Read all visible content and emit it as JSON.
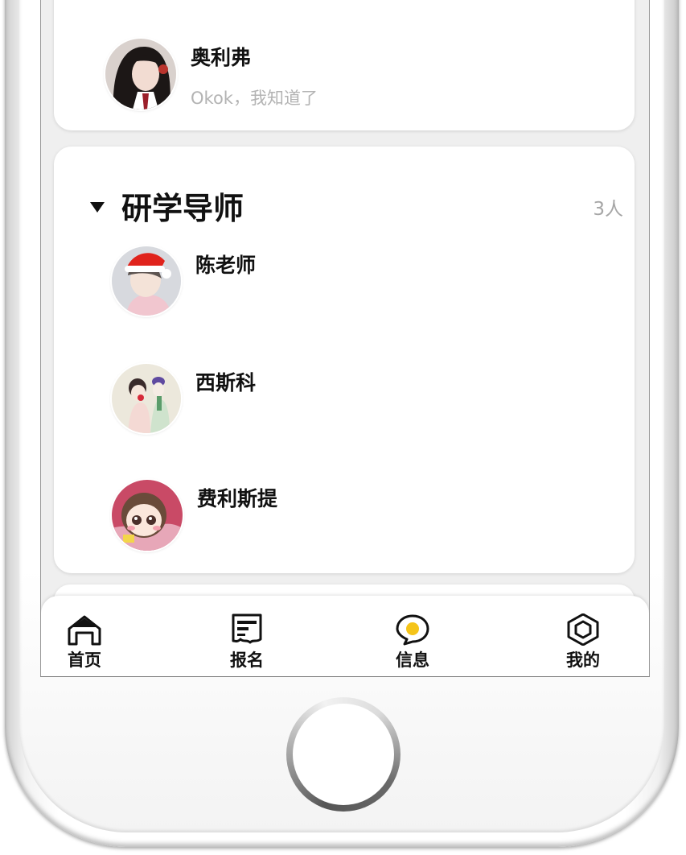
{
  "top_contact": {
    "name": "奥利弗",
    "last_message": "Okok，我知道了"
  },
  "group": {
    "title": "研学导师",
    "count": "3人",
    "members": [
      {
        "name": "陈老师"
      },
      {
        "name": "西斯科"
      },
      {
        "name": "费利斯提"
      }
    ]
  },
  "tabbar": {
    "items": [
      {
        "label": "首页",
        "icon": "home-icon"
      },
      {
        "label": "报名",
        "icon": "form-icon"
      },
      {
        "label": "信息",
        "icon": "chat-bubble-icon"
      },
      {
        "label": "我的",
        "icon": "hexagon-profile-icon"
      }
    ]
  },
  "colors": {
    "accent_yellow": "#F5C419",
    "text_primary": "#111111",
    "text_secondary": "#B3B3B3",
    "background": "#EFEFEF"
  }
}
